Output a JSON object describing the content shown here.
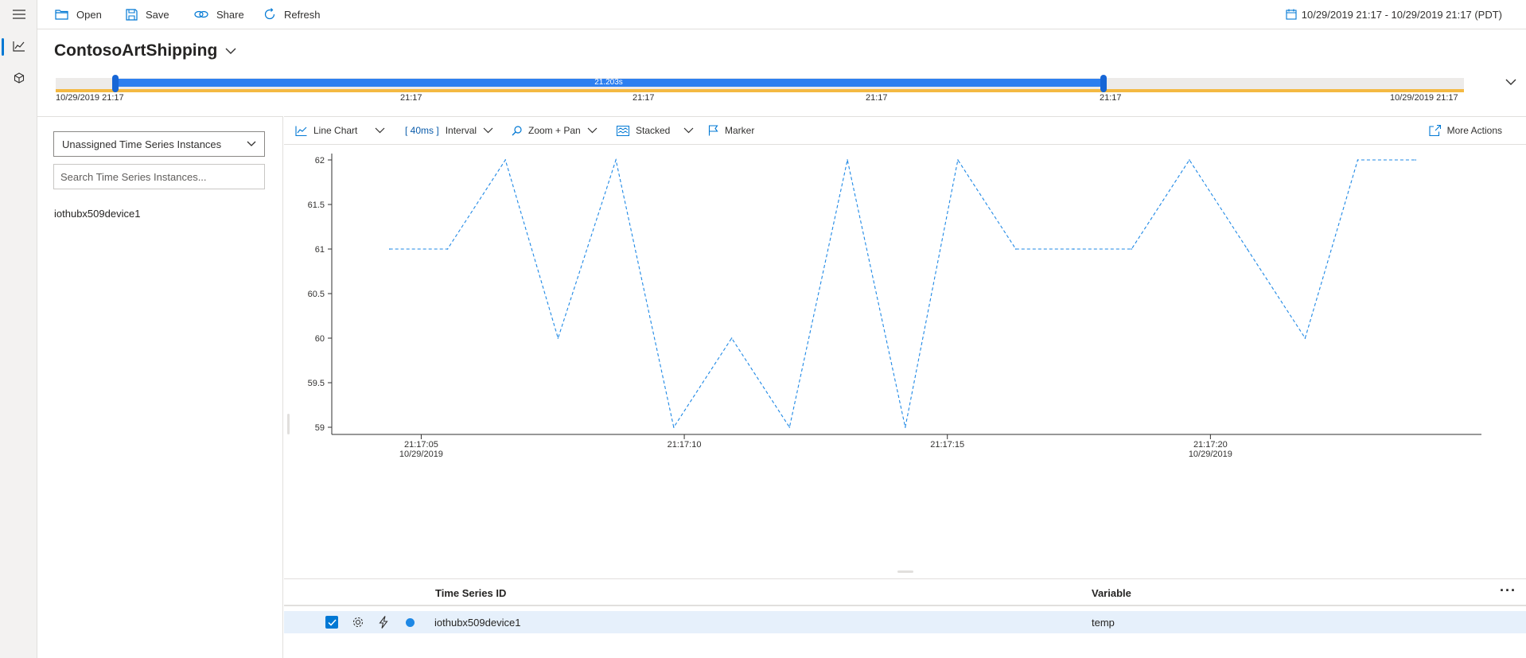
{
  "toolbar": {
    "open_label": "Open",
    "save_label": "Save",
    "share_label": "Share",
    "refresh_label": "Refresh",
    "date_range": "10/29/2019 21:17 - 10/29/2019 21:17 (PDT)"
  },
  "environment": {
    "name": "ContosoArtShipping"
  },
  "availability": {
    "selection_duration": "21.203s",
    "labels": [
      "10/29/2019 21:17",
      "21:17",
      "21:17",
      "21:17",
      "21:17",
      "10/29/2019 21:17"
    ]
  },
  "left_panel": {
    "hierarchy_dropdown": "Unassigned Time Series Instances",
    "search_placeholder": "Search Time Series Instances...",
    "instances": [
      "iothubx509device1"
    ]
  },
  "chart_toolbar": {
    "chart_type": "Line Chart",
    "interval_value": "[ 40ms ]",
    "interval_label": "Interval",
    "zoom_label": "Zoom + Pan",
    "stacked_label": "Stacked",
    "marker_label": "Marker",
    "more_actions_label": "More Actions"
  },
  "chart_data": {
    "type": "line",
    "series": [
      {
        "values": [
          [
            "21:17:04.4",
            61
          ],
          [
            "21:17:05.5",
            61
          ],
          [
            "21:17:06.6",
            62
          ],
          [
            "21:17:07.6",
            60
          ],
          [
            "21:17:08.7",
            62
          ],
          [
            "21:17:09.8",
            59
          ],
          [
            "21:17:10.9",
            60
          ],
          [
            "21:17:12.0",
            59
          ],
          [
            "21:17:13.1",
            62
          ],
          [
            "21:17:14.2",
            59
          ],
          [
            "21:17:15.2",
            62
          ],
          [
            "21:17:16.3",
            61
          ],
          [
            "21:17:17.4",
            61
          ],
          [
            "21:17:18.5",
            61
          ],
          [
            "21:17:19.6",
            62
          ],
          [
            "21:17:20.7",
            61
          ],
          [
            "21:17:21.8",
            60
          ],
          [
            "21:17:22.8",
            62
          ],
          [
            "21:17:23.9",
            62
          ]
        ]
      }
    ],
    "x_ticks": [
      {
        "time": "21:17:05",
        "date": "10/29/2019"
      },
      {
        "time": "21:17:10",
        "date": ""
      },
      {
        "time": "21:17:15",
        "date": ""
      },
      {
        "time": "21:17:20",
        "date": "10/29/2019"
      }
    ],
    "y_ticks": [
      "59",
      "59.5",
      "60",
      "60.5",
      "61",
      "61.5",
      "62"
    ],
    "ylim": [
      59,
      62
    ],
    "xlim": [
      "21:17:03.3",
      "21:17:25.0"
    ],
    "line_color": "#1e88e5",
    "line_style": "dashed",
    "grid": false
  },
  "grid": {
    "col_id": "Time Series ID",
    "col_variable": "Variable",
    "rows": [
      {
        "id": "iothubx509device1",
        "variable": "temp",
        "color": "#1e88e5"
      }
    ]
  }
}
